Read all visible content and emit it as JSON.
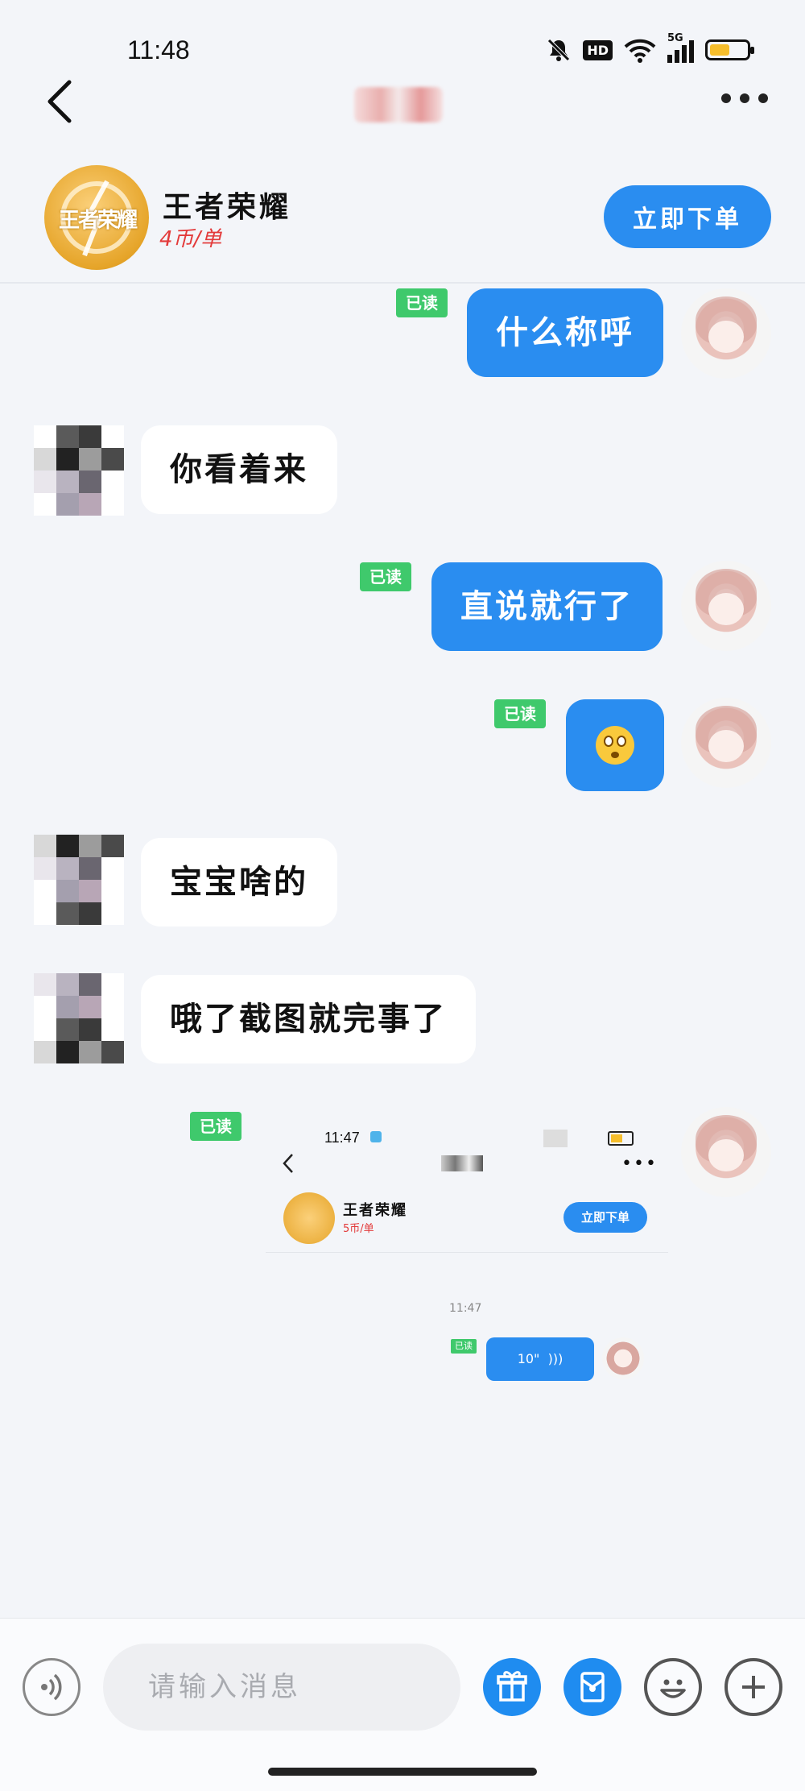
{
  "status_bar": {
    "time": "11:48",
    "network": "5G",
    "hd_label": "HD",
    "battery_level": 0.55
  },
  "nav": {
    "back_icon": "chevron-left-icon",
    "more_icon": "ellipsis-icon"
  },
  "game": {
    "name": "王者荣耀",
    "price": "4币/单",
    "logo_text": "王者荣耀",
    "order_button": "立即下单"
  },
  "messages": [
    {
      "side": "out",
      "text": "什么称呼",
      "read": "已读"
    },
    {
      "side": "in",
      "text": "你看着来"
    },
    {
      "side": "out",
      "text": "直说就行了",
      "read": "已读"
    },
    {
      "side": "out",
      "emoji": "flushed-face",
      "read": "已读"
    },
    {
      "side": "in",
      "text": "宝宝啥的"
    },
    {
      "side": "in",
      "text": "哦了截图就完事了"
    },
    {
      "side": "out",
      "type": "image",
      "read": "已读"
    }
  ],
  "screenshot": {
    "time": "11:47",
    "game_name": "王者荣耀",
    "price": "5币/单",
    "order_button": "立即下单",
    "msg_time": "11:47",
    "read": "已读",
    "voice_duration": "10\""
  },
  "input": {
    "placeholder": "请输入消息"
  },
  "colors": {
    "accent": "#2a8df0",
    "read_badge": "#3fc96c",
    "price": "#e33b3b"
  }
}
